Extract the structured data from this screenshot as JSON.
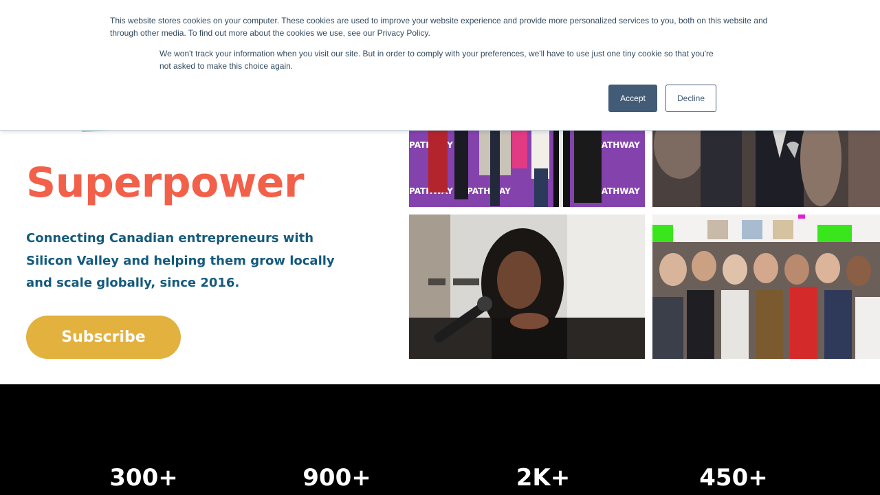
{
  "cookie_banner": {
    "text_primary": "This website stores cookies on your computer. These cookies are used to improve your website experience and provide more personalized services to you, both on this website and through other media. To find out more about the cookies we use, see our Privacy Policy.",
    "text_secondary": "We won't track your information when you visit our site. But in order to comply with your preferences, we'll have to use just one tiny cookie so that you're not asked to make this choice again.",
    "accept_label": "Accept",
    "decline_label": "Decline"
  },
  "hero": {
    "title": "Superpower",
    "subtitle": "Connecting Canadian entrepreneurs with Silicon Valley and helping them grow locally and scale globally, since 2016.",
    "subscribe_label": "Subscribe",
    "photo_banner_text": "PATHWAY"
  },
  "stats": [
    {
      "value": "300+"
    },
    {
      "value": "900+"
    },
    {
      "value": "2K+"
    },
    {
      "value": "450+"
    }
  ],
  "colors": {
    "title": "#f2604a",
    "subtitle": "#145a7d",
    "subscribe_bg": "#e2b13e",
    "accept_bg": "#425b76",
    "stats_bg": "#000000"
  }
}
